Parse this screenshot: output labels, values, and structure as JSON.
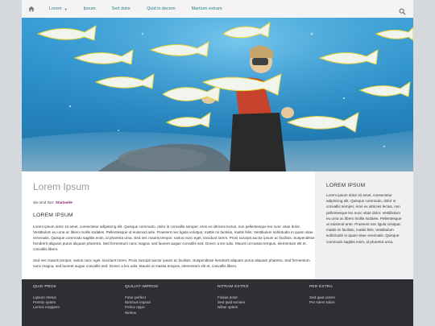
{
  "nav": {
    "items": [
      {
        "label": "Lorem",
        "has_caret": true
      },
      {
        "label": "Ipsum",
        "has_caret": false
      },
      {
        "label": "Sed dolor",
        "has_caret": false
      },
      {
        "label": "Quid in decem",
        "has_caret": false
      },
      {
        "label": "Martium extram",
        "has_caret": false
      }
    ],
    "home_icon": "home-icon",
    "search_icon": "search-icon",
    "accent": "#2b7d8c"
  },
  "hero": {
    "description_icon": "underwater-photo"
  },
  "main": {
    "title": "Lorem Ipsum",
    "breadcrumb_prefix": "Sie sind hier:",
    "breadcrumb_current": "Startseite",
    "section_heading": "LOREM IPSUM",
    "paragraph1": "Lorem ipsum dolor sit amet, consectetur adipiscing elit. Quisque commodo, dolor in convallis semper, eros ex ultricies lectus, non pellentesque leo nunc vitae dolor. Vestibulum eu urna ac libero mollis sodales. Pellentesque ut euismod ante. Praesent nec ligula volutpat, mattis mi facilisis, mattis felis. Vestibulum sollicitudin in quam vitae venenatis. Quisque commodo sagittis enim, id pharetra urna. Sed nec mauris tempor, varius nunc eget, tincidunt lorem. Proin suscipit auctor ipsum ac facilisis. Suspendisse hendrerit aliquam purus aliquam pharetra. Sed fermentum nunc magna, sed laoreet augue convallis sed. Donec a leo odio. Mauris ut massa tempus, elementum elit et, convallis libero.",
    "paragraph2": "Sed nec mauris tempor, varius nunc eget, tincidunt lorem. Proin suscipit auctor ipsum ac facilisis. Suspendisse hendrerit aliquam purus aliquam pharetra. Sed fermentum nunc magna, sed laoreet augue convallis sed. Donec a leo odio. Mauris ut massa tempus, elementum elit et, convallis libero."
  },
  "sidebar": {
    "heading": "LOREM IPSUM",
    "text": "Lorem ipsum dolor sit amet, consectetur adipiscing elit. Quisque commodo, dolor in convallis semper, eros ex ultricies lectus, non pellentesque leo nunc vitae dolor. Vestibulum eu urna ac libero mollis sodales. Pellentesque ut euismod ante. Praesent nec ligula volutpat, mattis mi facilisis, mattis felis. Vestibulum sollicitudin in quam vitae venenatis. Quisque commodo sagittis enim, id pharetra urna."
  },
  "footer": {
    "columns": [
      {
        "heading": "QUID PROS",
        "links": [
          "Lipsum rhetus",
          "Permix optem",
          "Lermix moppem"
        ]
      },
      {
        "heading": "QUILIAT IMPROS",
        "links": [
          "Futur perfect",
          "Nimmus impras",
          "Perlox oppo",
          "Nimius"
        ]
      },
      {
        "heading": "NITRAM EXTRO",
        "links": [
          "Finitas dolor",
          "Sed quid exctem",
          "Nillas optem"
        ]
      },
      {
        "heading": "PER EXTRA",
        "links": [
          "Sed quid octem",
          "Per sitem tulios"
        ]
      }
    ]
  }
}
